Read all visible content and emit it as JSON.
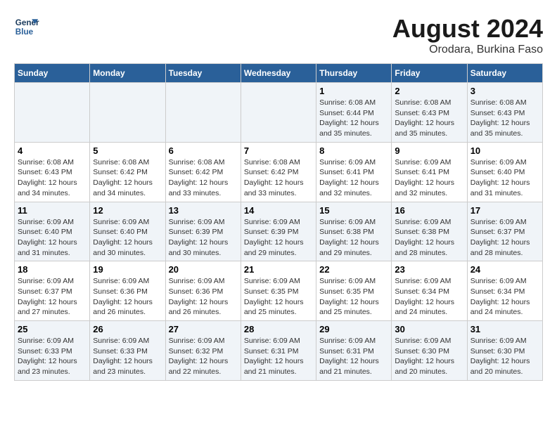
{
  "header": {
    "logo_line1": "General",
    "logo_line2": "Blue",
    "main_title": "August 2024",
    "subtitle": "Orodara, Burkina Faso"
  },
  "days_of_week": [
    "Sunday",
    "Monday",
    "Tuesday",
    "Wednesday",
    "Thursday",
    "Friday",
    "Saturday"
  ],
  "weeks": [
    [
      {
        "day": "",
        "info": ""
      },
      {
        "day": "",
        "info": ""
      },
      {
        "day": "",
        "info": ""
      },
      {
        "day": "",
        "info": ""
      },
      {
        "day": "1",
        "info": "Sunrise: 6:08 AM\nSunset: 6:44 PM\nDaylight: 12 hours\nand 35 minutes."
      },
      {
        "day": "2",
        "info": "Sunrise: 6:08 AM\nSunset: 6:43 PM\nDaylight: 12 hours\nand 35 minutes."
      },
      {
        "day": "3",
        "info": "Sunrise: 6:08 AM\nSunset: 6:43 PM\nDaylight: 12 hours\nand 35 minutes."
      }
    ],
    [
      {
        "day": "4",
        "info": "Sunrise: 6:08 AM\nSunset: 6:43 PM\nDaylight: 12 hours\nand 34 minutes."
      },
      {
        "day": "5",
        "info": "Sunrise: 6:08 AM\nSunset: 6:42 PM\nDaylight: 12 hours\nand 34 minutes."
      },
      {
        "day": "6",
        "info": "Sunrise: 6:08 AM\nSunset: 6:42 PM\nDaylight: 12 hours\nand 33 minutes."
      },
      {
        "day": "7",
        "info": "Sunrise: 6:08 AM\nSunset: 6:42 PM\nDaylight: 12 hours\nand 33 minutes."
      },
      {
        "day": "8",
        "info": "Sunrise: 6:09 AM\nSunset: 6:41 PM\nDaylight: 12 hours\nand 32 minutes."
      },
      {
        "day": "9",
        "info": "Sunrise: 6:09 AM\nSunset: 6:41 PM\nDaylight: 12 hours\nand 32 minutes."
      },
      {
        "day": "10",
        "info": "Sunrise: 6:09 AM\nSunset: 6:40 PM\nDaylight: 12 hours\nand 31 minutes."
      }
    ],
    [
      {
        "day": "11",
        "info": "Sunrise: 6:09 AM\nSunset: 6:40 PM\nDaylight: 12 hours\nand 31 minutes."
      },
      {
        "day": "12",
        "info": "Sunrise: 6:09 AM\nSunset: 6:40 PM\nDaylight: 12 hours\nand 30 minutes."
      },
      {
        "day": "13",
        "info": "Sunrise: 6:09 AM\nSunset: 6:39 PM\nDaylight: 12 hours\nand 30 minutes."
      },
      {
        "day": "14",
        "info": "Sunrise: 6:09 AM\nSunset: 6:39 PM\nDaylight: 12 hours\nand 29 minutes."
      },
      {
        "day": "15",
        "info": "Sunrise: 6:09 AM\nSunset: 6:38 PM\nDaylight: 12 hours\nand 29 minutes."
      },
      {
        "day": "16",
        "info": "Sunrise: 6:09 AM\nSunset: 6:38 PM\nDaylight: 12 hours\nand 28 minutes."
      },
      {
        "day": "17",
        "info": "Sunrise: 6:09 AM\nSunset: 6:37 PM\nDaylight: 12 hours\nand 28 minutes."
      }
    ],
    [
      {
        "day": "18",
        "info": "Sunrise: 6:09 AM\nSunset: 6:37 PM\nDaylight: 12 hours\nand 27 minutes."
      },
      {
        "day": "19",
        "info": "Sunrise: 6:09 AM\nSunset: 6:36 PM\nDaylight: 12 hours\nand 26 minutes."
      },
      {
        "day": "20",
        "info": "Sunrise: 6:09 AM\nSunset: 6:36 PM\nDaylight: 12 hours\nand 26 minutes."
      },
      {
        "day": "21",
        "info": "Sunrise: 6:09 AM\nSunset: 6:35 PM\nDaylight: 12 hours\nand 25 minutes."
      },
      {
        "day": "22",
        "info": "Sunrise: 6:09 AM\nSunset: 6:35 PM\nDaylight: 12 hours\nand 25 minutes."
      },
      {
        "day": "23",
        "info": "Sunrise: 6:09 AM\nSunset: 6:34 PM\nDaylight: 12 hours\nand 24 minutes."
      },
      {
        "day": "24",
        "info": "Sunrise: 6:09 AM\nSunset: 6:34 PM\nDaylight: 12 hours\nand 24 minutes."
      }
    ],
    [
      {
        "day": "25",
        "info": "Sunrise: 6:09 AM\nSunset: 6:33 PM\nDaylight: 12 hours\nand 23 minutes."
      },
      {
        "day": "26",
        "info": "Sunrise: 6:09 AM\nSunset: 6:33 PM\nDaylight: 12 hours\nand 23 minutes."
      },
      {
        "day": "27",
        "info": "Sunrise: 6:09 AM\nSunset: 6:32 PM\nDaylight: 12 hours\nand 22 minutes."
      },
      {
        "day": "28",
        "info": "Sunrise: 6:09 AM\nSunset: 6:31 PM\nDaylight: 12 hours\nand 21 minutes."
      },
      {
        "day": "29",
        "info": "Sunrise: 6:09 AM\nSunset: 6:31 PM\nDaylight: 12 hours\nand 21 minutes."
      },
      {
        "day": "30",
        "info": "Sunrise: 6:09 AM\nSunset: 6:30 PM\nDaylight: 12 hours\nand 20 minutes."
      },
      {
        "day": "31",
        "info": "Sunrise: 6:09 AM\nSunset: 6:30 PM\nDaylight: 12 hours\nand 20 minutes."
      }
    ]
  ]
}
